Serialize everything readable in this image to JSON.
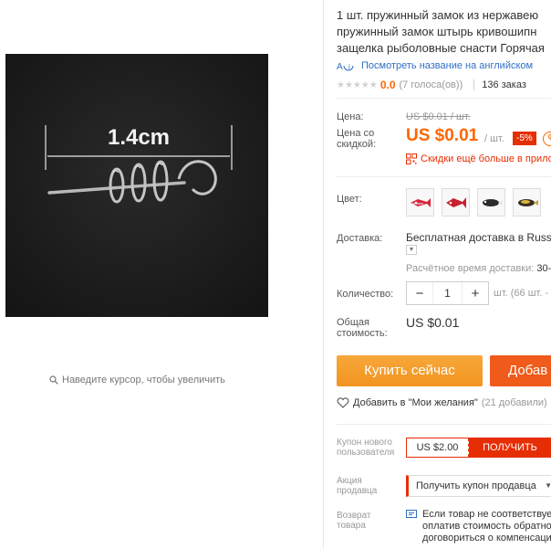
{
  "gallery": {
    "dimension_label": "1.4cm",
    "zoom_hint": "Наведите курсор, чтобы увеличить"
  },
  "product": {
    "title_lines": [
      "1 шт. пружинный замок из нержавею",
      "пружинный замок штырь кривошипн",
      "защелка рыболовные снасти Горячая"
    ],
    "translate_link": "Посмотреть название на английском",
    "rating": "0.0",
    "votes": "(7 голоса(ов))",
    "orders": "136 заказ"
  },
  "price": {
    "label": "Цена:",
    "old": "US $0.01 / шт.",
    "discount_label_1": "Цена со",
    "discount_label_2": "скидкой:",
    "new": "US $0.01",
    "per_unit": "/ шт.",
    "discount_badge": "-5%",
    "more_discount": "Скидки ещё больше в прилож"
  },
  "color": {
    "label": "Цвет:",
    "swatches": [
      "red-white-lure",
      "red-white-lure",
      "black-white-lure",
      "gold-lure"
    ]
  },
  "shipping": {
    "label": "Доставка:",
    "method": "Бесплатная доставка в Russia",
    "estimate_prefix": "Расчётное время доставки:",
    "estimate_value": "30-"
  },
  "quantity": {
    "label": "Количество:",
    "minus": "−",
    "value": "1",
    "plus": "+",
    "note": "шт. (66 шт. -"
  },
  "total": {
    "label_1": "Общая",
    "label_2": "стоимость:",
    "value": "US $0.01"
  },
  "actions": {
    "buy": "Купить сейчас",
    "cart": "Добав",
    "wishlist": "Добавить в \"Мои желания\"",
    "wishlist_count": "(21 добавили)"
  },
  "coupons": {
    "new_user_label": [
      "Купон нового",
      "пользователя"
    ],
    "new_user_amount": "US $2.00",
    "new_user_button": "ПОЛУЧИТЬ",
    "seller_label": [
      "Акция",
      "продавца"
    ],
    "seller_button": "Получить купон продавца",
    "return_label": [
      "Возврат",
      "товара"
    ],
    "return_text": [
      "Если товар не соответствует",
      "оплатив стоимость обратно",
      "договориться о компенсаци"
    ]
  },
  "colors": {
    "accent": "#ff6600",
    "red": "#e62e04",
    "link": "#2e6fc4",
    "buy_button": "#f29420",
    "cart_button": "#f05a1a"
  }
}
